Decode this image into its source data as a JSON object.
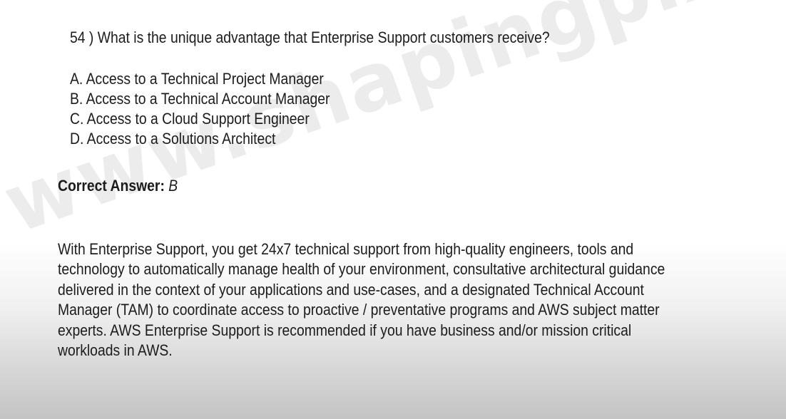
{
  "watermark": "www.shapingpixel.com",
  "question": {
    "text": "54 ) What is the unique advantage that Enterprise Support customers receive?"
  },
  "options": [
    "A. Access to a Technical Project Manager",
    "B. Access to a Technical Account Manager",
    "C. Access to a Cloud Support Engineer",
    "D. Access to a Solutions Architect"
  ],
  "answer": {
    "label": "Correct Answer:",
    "value": "B"
  },
  "explanation": "With Enterprise Support, you get 24x7 technical support from high-quality engineers, tools and technology to automatically manage health of your environment, consultative architectural guidance delivered in the context of your applications and use-cases, and a designated Technical Account Manager (TAM) to coordinate access to proactive / preventative programs and AWS subject matter experts. AWS Enterprise Support is recommended if you have business and/or mission critical workloads in AWS."
}
